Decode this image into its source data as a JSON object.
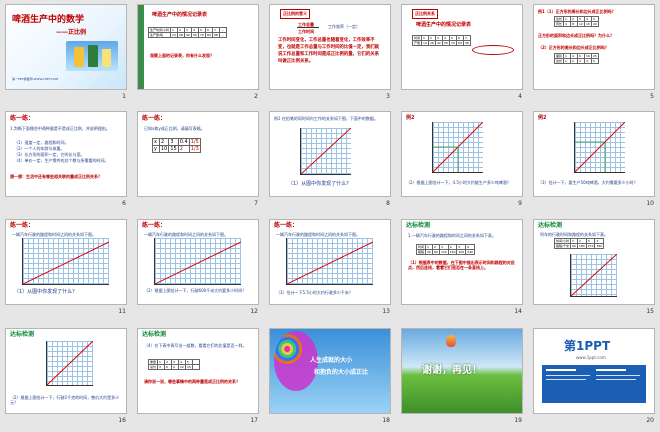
{
  "slides": [
    {
      "n": "1",
      "title": "啤酒生产中的数学",
      "subtitle": "——正比例",
      "footer": "第一PPT模板网-WWW.1PPT.COM"
    },
    {
      "n": "2",
      "title": "啤酒生产中的情况记录表",
      "rows": [
        "生产时间/小时",
        "生产量/吨"
      ],
      "time": [
        "1",
        "2",
        "3",
        "4",
        "5",
        "6",
        "7",
        "…"
      ],
      "qty": [
        "14",
        "28",
        "42",
        "56",
        "70",
        "84",
        "98",
        "…"
      ],
      "question": "观察上面的记录表，你有什么发现？"
    },
    {
      "n": "3",
      "tag": "正比例的意义",
      "f1": "工作总量",
      "f2": "工作效率（一定）",
      "f3": "工作时间",
      "body": "工作时间变化，工作总量也随着变化，工作效率不变，也就是工作总量与工作时间的比值一定，我们就说工作总量和工作时间是成正比例的量，它们的关系叫做正比例关系。"
    },
    {
      "n": "4",
      "tag": "正比例关系",
      "title": "啤酒生产中的情况记录表",
      "time": [
        "1",
        "2",
        "3",
        "4",
        "5",
        "6",
        "7"
      ],
      "qty": [
        "14",
        "28",
        "42",
        "56",
        "70",
        "84",
        "98"
      ]
    },
    {
      "n": "5",
      "q1": "例1（1）正方形的周长和边长成正比例吗？",
      "q1b": "正方形的面积和边长成正比例吗？为什么？",
      "q2": "（2）正方形的周长和边长成正比例吗？",
      "rows": [
        "周长",
        "边长"
      ]
    },
    {
      "n": "6",
      "title": "练一练：",
      "intro": "1.判断下面哪些中两种量是不是成正比例，并说明理由。",
      "items": [
        "（1）速度一定，路程和时间。",
        "（2）一个人的年龄与体重。",
        "（3）长方形的面积一定，它的长与宽。",
        "（4）单价一定，生产零件的总个数与所需要的时间。"
      ],
      "q": "想一想：生活中还有哪些相关联的量成正比例关系？"
    },
    {
      "n": "7",
      "title": "练一练：",
      "intro": "已知x和y成正比例，请填写表格。",
      "rows": [
        "x",
        "y"
      ],
      "x": [
        "2",
        "3",
        "0.4"
      ],
      "y": [
        "10",
        "15",
        ""
      ],
      "fracs": [
        "1/5",
        "1/3"
      ]
    },
    {
      "n": "8",
      "intro": "例2 在铅笔的同时间内工作的关系如下图，下面中的数据。",
      "q": "（1）从图中你发现了什么？"
    },
    {
      "n": "9",
      "title": "例2",
      "q": "（2）根据上图估计一下，4.5小时大约能生产多少吨啤酒？"
    },
    {
      "n": "10",
      "title": "例2",
      "q": "（3）估计一下，要生产56吨啤酒，大约需要多少小时？"
    },
    {
      "n": "11",
      "title": "练一练：",
      "intro": "一辆汽车行驶的路程和时间之间的关系如下图。",
      "q": "（1）从图中你发现了什么？"
    },
    {
      "n": "12",
      "title": "练一练：",
      "intro": "一辆汽车行驶的路程和时间之间的关系如下图。",
      "q": "（2）根据上图估计一下，行驶600千米大约要多少时间？"
    },
    {
      "n": "13",
      "title": "练一练：",
      "intro": "一辆汽车行驶的路程和时间之间的关系如下图。",
      "q": "（3）估计一下5.5小时大约行驶多少千米？"
    },
    {
      "n": "14",
      "title": "达标检测",
      "intro": "1.一辆汽车行驶的路程和时间之间的关系如下表。",
      "q": "（1）根据表中的数据，在下图中描出表示时间和路程的对应点，然后连线，看看它们是否在一条直线上。"
    },
    {
      "n": "15",
      "title": "达标检测",
      "intro": "列车的行驶时间和路程的关系如下表。",
      "rows": [
        "时间/小时",
        "路程/千米"
      ]
    },
    {
      "n": "16",
      "title": "达标检测",
      "q": "（2）根据上图估计一下，行驶2千克的时间，售价大约是多少元？"
    },
    {
      "n": "17",
      "title": "达标检测",
      "intro": "（4）在下表中再写出一组数，看看它们的比值是否一样。",
      "note": "请你说一说，哪些事情中的两种量是成正比例的关系？"
    },
    {
      "n": "18",
      "line1": "人生成就的大小",
      "line2": "和抱负的大小成正比"
    },
    {
      "n": "19",
      "text": "谢谢，再见！"
    },
    {
      "n": "20",
      "logo": "第1PPT",
      "sub": "www.1ppt.com"
    }
  ],
  "colors": {
    "accent": "#3a6fb5",
    "title_red": "#c00000",
    "green": "#3c8d4b",
    "grid": "#9cc3e6"
  }
}
